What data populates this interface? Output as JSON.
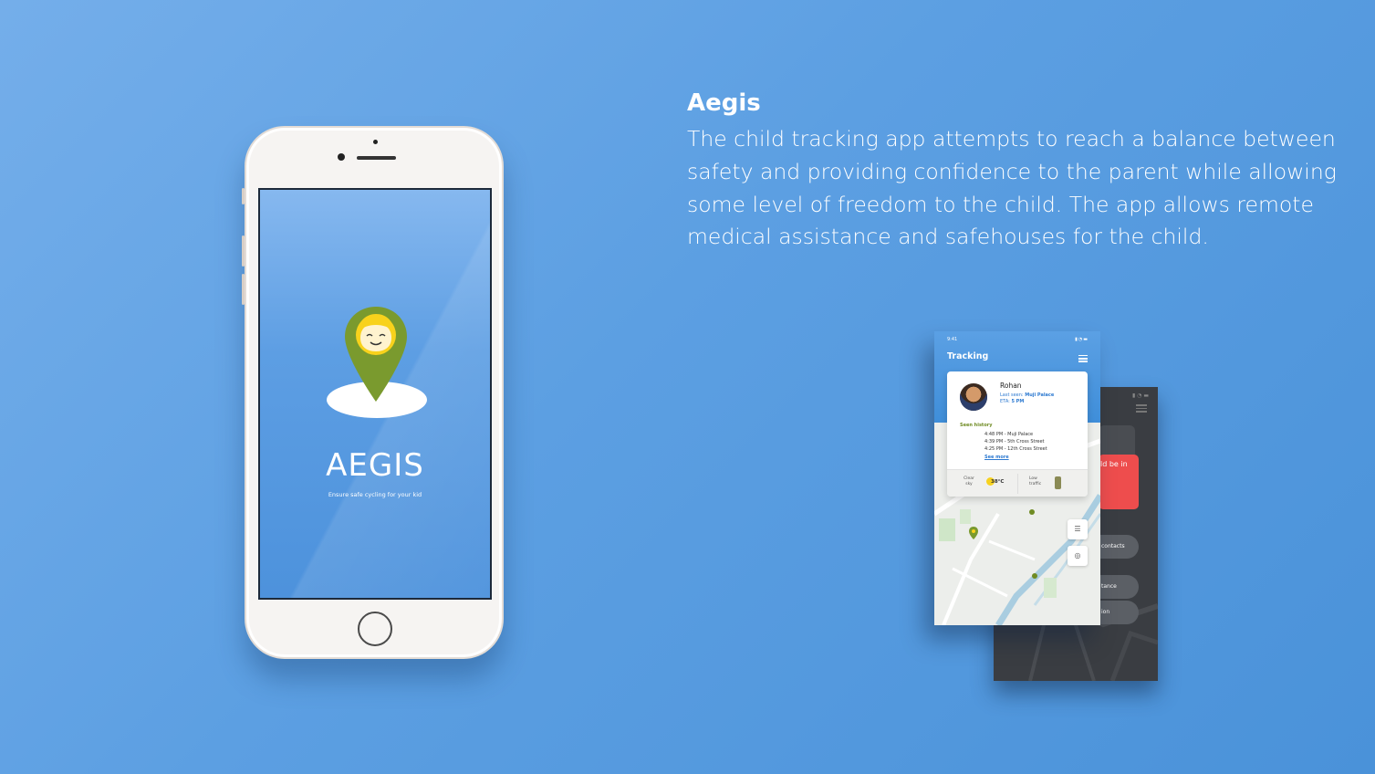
{
  "project": {
    "title": "Aegis",
    "description": "The child tracking app attempts to reach a balance between safety and providing confidence to the parent while allowing some level of freedom to the child. The app allows remote medical assistance and safehouses for the child."
  },
  "splash_screen": {
    "app_name": "AEGIS",
    "tagline": "Ensure safe cycling for your kid"
  },
  "tracking_screen": {
    "status_time": "9:41",
    "header_title": "Tracking",
    "kid_name": "Rohan",
    "last_seen_label": "Last seen:",
    "last_seen_value": "Muji Palace",
    "eta_label": "ETA:",
    "eta_value": "5 PM",
    "history_title": "Seen history",
    "history": [
      "4:48 PM - Muji Palace",
      "4:39 PM - 5th Cross Street",
      "4:25 PM - 12th Cross Street"
    ],
    "see_more": "See more",
    "weather_label": "Clear sky",
    "temperature": "38°C",
    "traffic_label": "Low traffic"
  },
  "alert_screen": {
    "alert_fragment": "ld be in",
    "pill_1": "contacts",
    "pill_2": "tance",
    "pill_3": "ion"
  },
  "colors": {
    "background": "#5c9fe2",
    "pin_green": "#7a9a2e",
    "alert_red": "#ee4d4d",
    "link_blue": "#2e7ad1"
  }
}
